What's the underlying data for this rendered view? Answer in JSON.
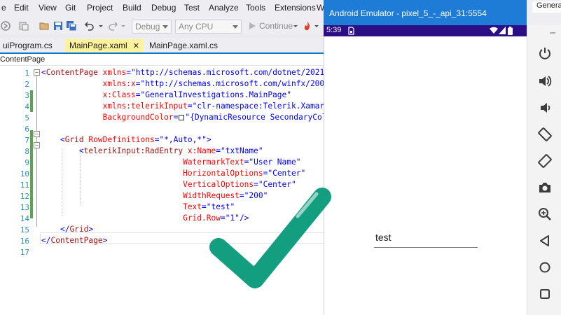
{
  "menu": [
    "e",
    "Edit",
    "View",
    "Git",
    "Project",
    "Build",
    "Debug",
    "Test",
    "Analyze",
    "Tools",
    "Extensions",
    "Wi"
  ],
  "toolbar": {
    "config": "Debug",
    "platform": "Any CPU",
    "continue_label": "Continue"
  },
  "tabs": [
    {
      "label": "uiProgram.cs",
      "active": false
    },
    {
      "label": "MainPage.xaml",
      "active": true
    },
    {
      "label": "MainPage.xaml.cs",
      "active": false
    }
  ],
  "tab_close_glyph": "✕",
  "navbar": {
    "label": "ContentPage"
  },
  "editor": {
    "line_numbers": [
      "1",
      "2",
      "3",
      "4",
      "5",
      "6",
      "7",
      "8",
      "9",
      "10",
      "11",
      "12",
      "13",
      "14",
      "15",
      "16",
      "17"
    ]
  },
  "vs_right_tab": "Genera",
  "emulator": {
    "title": "Android Emulator - pixel_5_-_api_31:5554",
    "status_time": "5:39",
    "accent": "#2d0f85",
    "title_color": "#1e7bd6"
  },
  "app": {
    "entry_text": "test"
  },
  "emulator_controls": [
    {
      "name": "power-icon"
    },
    {
      "name": "volume-up-icon"
    },
    {
      "name": "volume-down-icon"
    },
    {
      "name": "rotate-left-icon"
    },
    {
      "name": "rotate-right-icon"
    },
    {
      "name": "camera-icon"
    },
    {
      "name": "zoom-icon"
    },
    {
      "name": "back-icon"
    },
    {
      "name": "home-icon"
    },
    {
      "name": "overview-icon"
    }
  ],
  "overlay": {
    "icon": "checkmark-icon",
    "color": "#139e80"
  }
}
